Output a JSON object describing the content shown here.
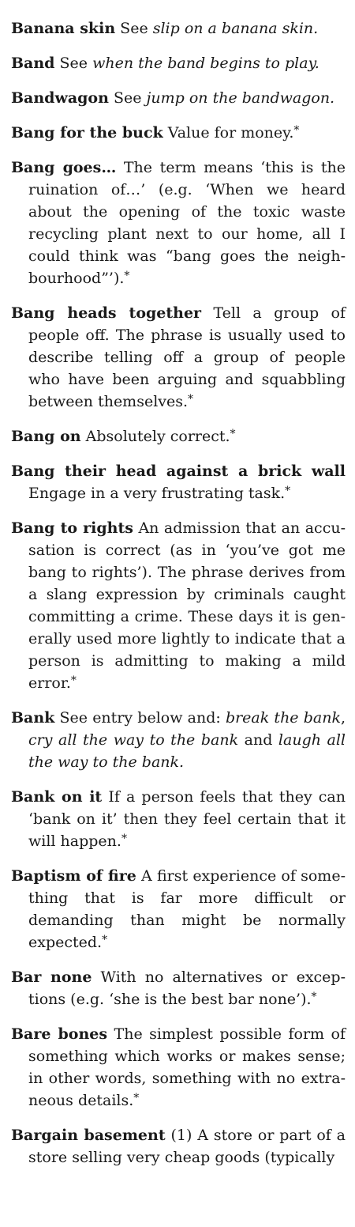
{
  "entries": [
    {
      "head": "Banana skin",
      "segments": [
        {
          "t": " See ",
          "i": false
        },
        {
          "t": "slip on a banana skin.",
          "i": true
        }
      ],
      "star": ""
    },
    {
      "head": "Band",
      "segments": [
        {
          "t": " See ",
          "i": false
        },
        {
          "t": "when the band begins to play.",
          "i": true
        }
      ],
      "star": ""
    },
    {
      "head": "Bandwagon",
      "segments": [
        {
          "t": " See ",
          "i": false
        },
        {
          "t": "jump on the bandwagon.",
          "i": true
        }
      ],
      "star": ""
    },
    {
      "head": "Bang for the buck",
      "segments": [
        {
          "t": " Value for money.",
          "i": false
        }
      ],
      "star": "*"
    },
    {
      "head": "Bang goes…",
      "segments": [
        {
          "t": " The term means ‘this is the ruination of…’ (e.g. ‘When we heard about the opening of the toxic waste recycling plant next to our home, all I could think was “bang goes the neigh­bourhood”’).",
          "i": false
        }
      ],
      "star": "*"
    },
    {
      "head": "Bang heads together",
      "segments": [
        {
          "t": " Tell a group of people off. The phrase is usually used to describe telling off a group of people who have been arguing and squabbling between themselves.",
          "i": false
        }
      ],
      "star": "*"
    },
    {
      "head": "Bang on",
      "segments": [
        {
          "t": " Absolutely correct.",
          "i": false
        }
      ],
      "star": "*"
    },
    {
      "head": "Bang their head against a brick wall",
      "segments": [
        {
          "t": " Engage in a very frustrating task.",
          "i": false
        }
      ],
      "star": "*"
    },
    {
      "head": "Bang to rights",
      "segments": [
        {
          "t": " An admission that an accu­sation is correct (as in ‘you’ve got me bang to rights’). The phrase derives from a slang expression by criminals caught committing a crime. These days it is gen­erally used more lightly to indicate that a person is admitting to making a mild error.",
          "i": false
        }
      ],
      "star": "*"
    },
    {
      "head": "Bank",
      "segments": [
        {
          "t": " See entry below and: ",
          "i": false
        },
        {
          "t": "break the bank",
          "i": true
        },
        {
          "t": ", ",
          "i": false
        },
        {
          "t": "cry all the way to the bank",
          "i": true
        },
        {
          "t": " and ",
          "i": false
        },
        {
          "t": "laugh all the way to the bank.",
          "i": true
        }
      ],
      "star": ""
    },
    {
      "head": "Bank on it",
      "segments": [
        {
          "t": " If a person feels that they can ‘bank on it’ then they feel certain that it will happen.",
          "i": false
        }
      ],
      "star": "*"
    },
    {
      "head": "Baptism of fire",
      "segments": [
        {
          "t": " A first experience of some­thing that is far more difficult or demanding than might be normally expected.",
          "i": false
        }
      ],
      "star": "*"
    },
    {
      "head": "Bar none",
      "segments": [
        {
          "t": " With no alternatives or excep­tions (e.g. ‘she is the best bar none’).",
          "i": false
        }
      ],
      "star": "*"
    },
    {
      "head": "Bare bones",
      "segments": [
        {
          "t": " The simplest possible form of something which works or makes sense; in other words, something with no extra­neous details.",
          "i": false
        }
      ],
      "star": "*"
    },
    {
      "head": "Bargain basement",
      "segments": [
        {
          "t": " (1) A store or part of a store selling very cheap goods (typically",
          "i": false
        }
      ],
      "star": ""
    }
  ]
}
